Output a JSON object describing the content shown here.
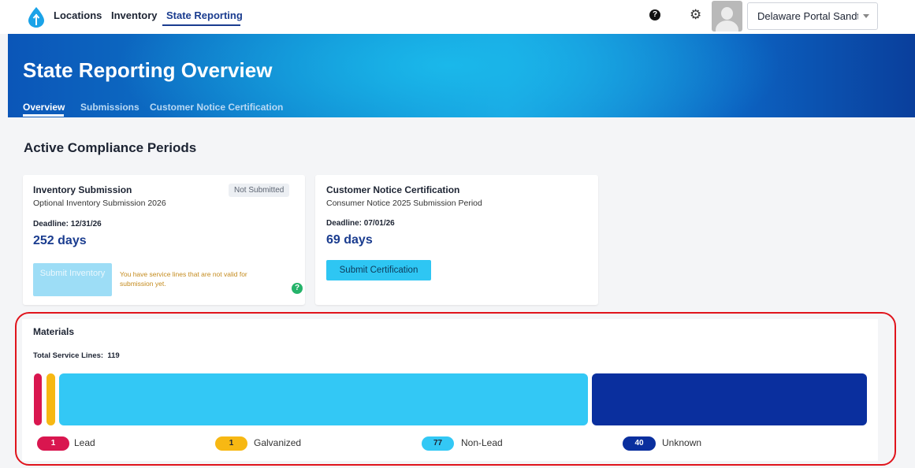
{
  "nav": {
    "items": [
      {
        "label": "Locations"
      },
      {
        "label": "Inventory"
      },
      {
        "label": "State Reporting"
      }
    ],
    "org_select": "Delaware Portal Sandt",
    "help_icon_glyph": "?",
    "gear_icon_glyph": "⚙"
  },
  "banner": {
    "title": "State Reporting Overview",
    "tabs": [
      {
        "label": "Overview"
      },
      {
        "label": "Submissions"
      },
      {
        "label": "Customer Notice Certification"
      }
    ]
  },
  "section_title": "Active Compliance Periods",
  "cards": {
    "inventory": {
      "title": "Inventory Submission",
      "status": "Not Submitted",
      "subtitle": "Optional Inventory Submission 2026",
      "deadline": "Deadline: 12/31/26",
      "days": "252 days",
      "button": "Submit Inventory",
      "warning": "You have service lines that are not valid for submission yet.",
      "help_glyph": "?"
    },
    "certification": {
      "title": "Customer Notice Certification",
      "subtitle": "Consumer Notice 2025 Submission Period",
      "deadline": "Deadline: 07/01/26",
      "days": "69 days",
      "button": "Submit Certification"
    }
  },
  "materials": {
    "title": "Materials",
    "total_label": "Total Service Lines:",
    "total_value": "119",
    "legend": [
      {
        "count": "1",
        "label": "Lead"
      },
      {
        "count": "1",
        "label": "Galvanized"
      },
      {
        "count": "77",
        "label": "Non-Lead"
      },
      {
        "count": "40",
        "label": "Unknown"
      }
    ],
    "colors": {
      "lead": "#d9164f",
      "galvanized": "#f7b813",
      "non_lead": "#33c8f5",
      "unknown": "#0a2f9e"
    }
  },
  "theme": {
    "nav_active": "#1a3c8f",
    "highlight": "#e0141c"
  }
}
